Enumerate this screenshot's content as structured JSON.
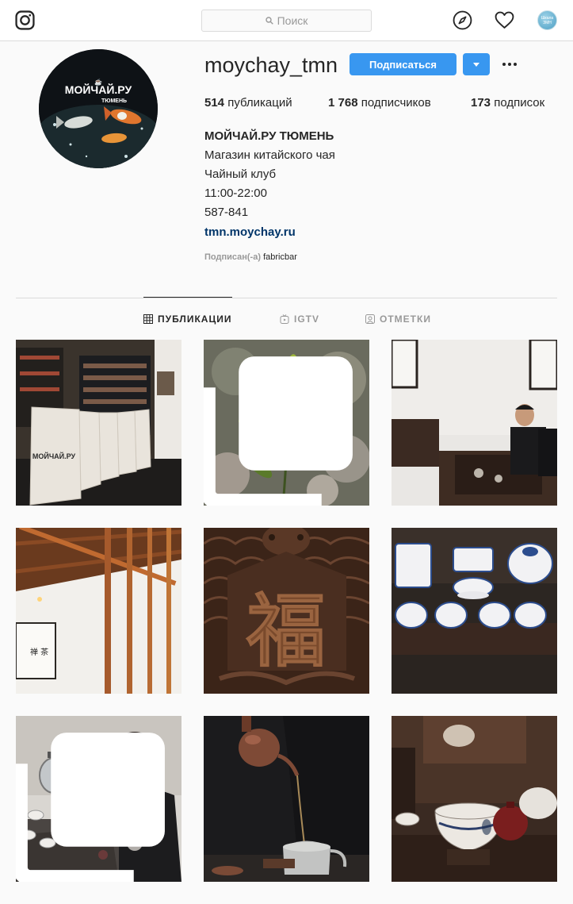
{
  "header": {
    "search_placeholder": "Поиск",
    "avatar_line1": "Шкала",
    "avatar_line2": "ЗМН"
  },
  "profile": {
    "username": "moychay_tmn",
    "follow_label": "Подписаться",
    "stats": {
      "posts_count": "514",
      "posts_label": "публикаций",
      "followers_count": "1 768",
      "followers_label": "подписчиков",
      "following_count": "173",
      "following_label": "подписок"
    },
    "full_name": "МОЙЧАЙ.РУ ТЮМЕНЬ",
    "bio": [
      "Магазин китайского чая",
      "Чайный клуб",
      "11:00-22:00",
      "587-841"
    ],
    "website": "tmn.moychay.ru",
    "followed_by_label": "Подписан(-а)",
    "followed_by_name": "fabricbar",
    "avatar_logo_line1": "МОЙЧАЙ.РУ",
    "avatar_logo_line2": "ТЮМЕНЬ"
  },
  "tabs": [
    {
      "label": "ПУБЛИКАЦИИ",
      "active": true,
      "icon": "grid-icon"
    },
    {
      "label": "IGTV",
      "active": false,
      "icon": "tv-icon"
    },
    {
      "label": "ОТМЕТКИ",
      "active": false,
      "icon": "tagged-icon"
    }
  ],
  "posts": [
    {
      "subject": "tea-bags-in-shop",
      "bag_text": "МОЙЧАЙ.РУ",
      "multi": false
    },
    {
      "subject": "tea-leaves",
      "multi": true
    },
    {
      "subject": "man-at-tea-table",
      "multi": false
    },
    {
      "subject": "interior-wood",
      "multi": false
    },
    {
      "subject": "carved-wood-fu",
      "multi": false
    },
    {
      "subject": "blue-white-cups",
      "multi": false
    },
    {
      "subject": "woman-pouring-tea",
      "multi": true
    },
    {
      "subject": "pouring-teapot",
      "multi": false
    },
    {
      "subject": "teaware-closeup",
      "multi": false
    }
  ]
}
